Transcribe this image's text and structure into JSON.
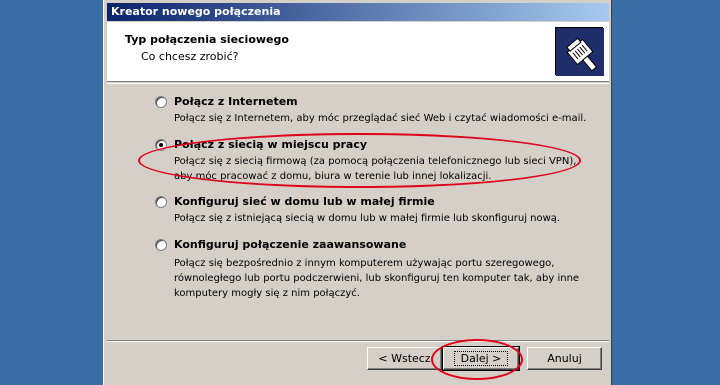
{
  "window": {
    "title": "Kreator nowego połączenia"
  },
  "header": {
    "title": "Typ połączenia sieciowego",
    "subtitle": "Co chcesz zrobić?",
    "icon": "network-cable-icon"
  },
  "options": [
    {
      "label": "Połącz z Internetem",
      "desc": [
        "Połącz się z Internetem, aby móc przeglądać sieć Web i czytać wiadomości e-mail."
      ],
      "checked": false
    },
    {
      "label": "Połącz z siecią w miejscu pracy",
      "desc": [
        "Połącz się z siecią firmową (za pomocą połączenia telefonicznego lub sieci VPN),",
        "aby móc pracować z domu, biura w terenie lub innej lokalizacji."
      ],
      "checked": true
    },
    {
      "label": "Konfiguruj sieć w domu lub w małej firmie",
      "desc": [
        "Połącz się z istniejącą siecią w domu lub w małej firmie lub skonfiguruj nową."
      ],
      "checked": false
    },
    {
      "label": "Konfiguruj połączenie zaawansowane",
      "desc": [
        "Połącz się bezpośrednio z innym komputerem używając portu szeregowego,",
        "równoległego lub portu podczerwieni, lub skonfiguruj ten komputer tak, aby inne",
        "komputery mogły się z nim połączyć."
      ],
      "checked": false
    }
  ],
  "buttons": {
    "back": "< Wstecz",
    "next": "Dalej >",
    "cancel": "Anuluj"
  },
  "colors": {
    "annotation": "#e0001a",
    "title_bar": "#0a246a",
    "dialog_bg": "#d4d0c8"
  }
}
